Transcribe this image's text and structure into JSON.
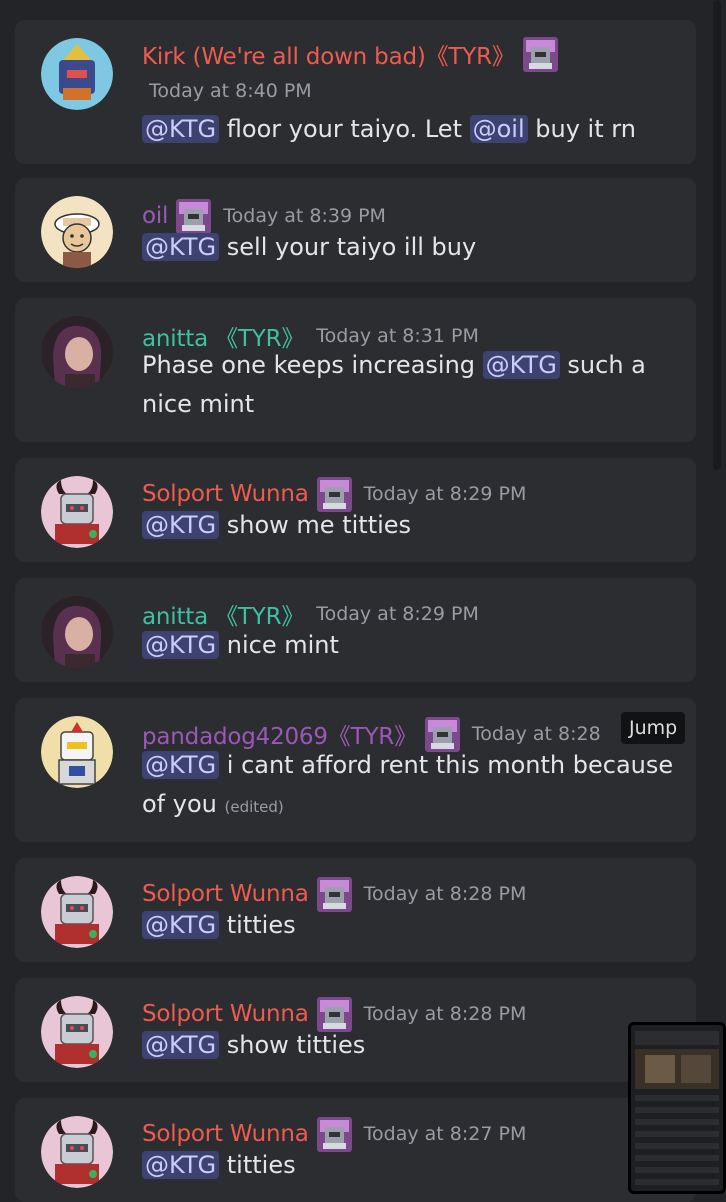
{
  "messages": [
    {
      "author": "Kirk (We're all down bad)《TYR》",
      "author_color": "#f05b4f",
      "timestamp": "Today at 8:40 PM",
      "avatar_icon": "robot-mech-avatar",
      "has_badge": true,
      "parts": [
        {
          "type": "mention",
          "text": "@KTG"
        },
        {
          "type": "text",
          "text": " floor your taiyo. Let "
        },
        {
          "type": "mention",
          "text": "@oil"
        },
        {
          "type": "text",
          "text": " buy it rn"
        }
      ]
    },
    {
      "author": "oil",
      "author_color": "#9b59b6",
      "timestamp": "Today at 8:39 PM",
      "avatar_icon": "cartoon-monkey-avatar",
      "has_badge": true,
      "parts": [
        {
          "type": "mention",
          "text": "@KTG"
        },
        {
          "type": "text",
          "text": " sell your taiyo ill buy"
        }
      ]
    },
    {
      "author": "anitta 《TYR》",
      "author_color": "#3ec1a0",
      "timestamp": "Today at 8:31 PM",
      "avatar_icon": "anime-girl-avatar",
      "has_badge": false,
      "lines": [
        [
          {
            "type": "text",
            "text": "Phase one keeps increasing "
          },
          {
            "type": "mention",
            "text": "@KTG"
          },
          {
            "type": "text",
            "text": " such a"
          }
        ],
        [
          {
            "type": "text",
            "text": "nice mint"
          }
        ]
      ]
    },
    {
      "author": "Solport Wunna",
      "author_color": "#f05b4f",
      "timestamp": "Today at 8:29 PM",
      "avatar_icon": "horned-robot-avatar",
      "has_badge": true,
      "parts": [
        {
          "type": "mention",
          "text": "@KTG"
        },
        {
          "type": "text",
          "text": " show me titties"
        }
      ]
    },
    {
      "author": "anitta 《TYR》",
      "author_color": "#3ec1a0",
      "timestamp": "Today at 8:29 PM",
      "avatar_icon": "anime-girl-avatar",
      "has_badge": false,
      "parts": [
        {
          "type": "mention",
          "text": "@KTG"
        },
        {
          "type": "text",
          "text": " nice mint"
        }
      ]
    },
    {
      "author": "pandadog42069《TYR》",
      "author_color": "#9b59b6",
      "timestamp": "Today at 8:28",
      "avatar_icon": "robot-pilot-avatar",
      "has_badge": true,
      "jump_label": "Jump",
      "lines": [
        [
          {
            "type": "mention",
            "text": "@KTG"
          },
          {
            "type": "text",
            "text": " i cant afford rent this month because"
          }
        ],
        [
          {
            "type": "text",
            "text": "of you "
          },
          {
            "type": "edited",
            "text": "(edited)"
          }
        ]
      ]
    },
    {
      "author": "Solport Wunna",
      "author_color": "#f05b4f",
      "timestamp": "Today at 8:28 PM",
      "avatar_icon": "horned-robot-avatar",
      "has_badge": true,
      "parts": [
        {
          "type": "mention",
          "text": "@KTG"
        },
        {
          "type": "text",
          "text": " titties"
        }
      ]
    },
    {
      "author": "Solport Wunna",
      "author_color": "#f05b4f",
      "timestamp": "Today at 8:28 PM",
      "avatar_icon": "horned-robot-avatar",
      "has_badge": true,
      "parts": [
        {
          "type": "mention",
          "text": "@KTG"
        },
        {
          "type": "text",
          "text": " show titties"
        }
      ]
    },
    {
      "author": "Solport Wunna",
      "author_color": "#f05b4f",
      "timestamp": "Today at 8:27 PM",
      "avatar_icon": "horned-robot-avatar",
      "has_badge": true,
      "parts": [
        {
          "type": "mention",
          "text": "@KTG"
        },
        {
          "type": "text",
          "text": " titties"
        }
      ]
    }
  ],
  "colors": {
    "background": "#232428",
    "card": "#2b2d31",
    "mention_bg": "#3d4270",
    "mention_text": "#c9cdfb",
    "timestamp": "#9a9ca3"
  }
}
